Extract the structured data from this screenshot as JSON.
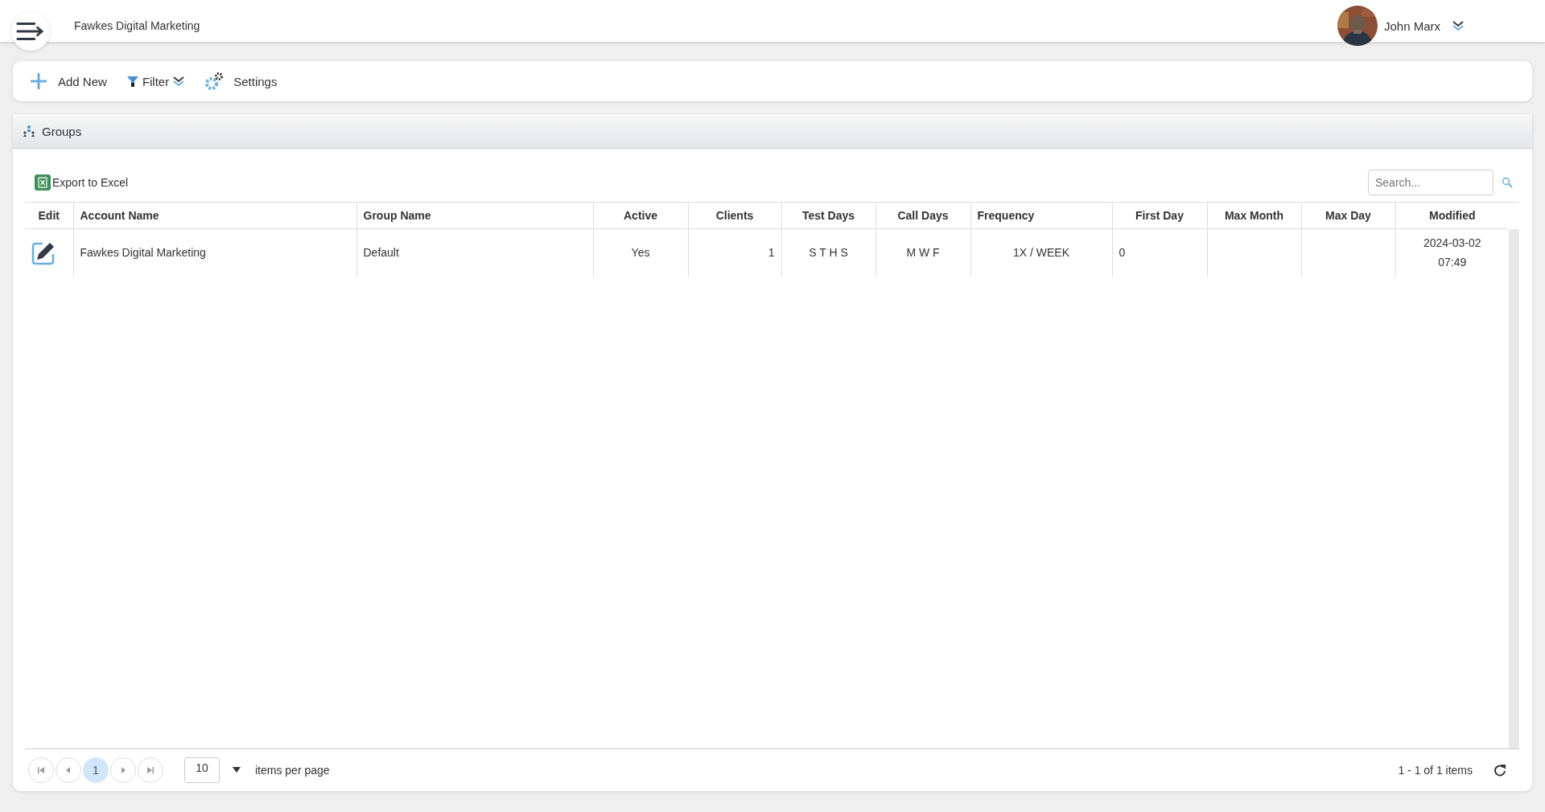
{
  "header": {
    "company": "Fawkes Digital Marketing",
    "user": {
      "name": "John Marx"
    }
  },
  "toolbar": [
    {
      "kind": "add",
      "label": "Add New"
    },
    {
      "kind": "filter",
      "label": "Filter"
    },
    {
      "kind": "settings",
      "label": "Settings"
    }
  ],
  "panel": {
    "title": "Groups",
    "export": "Export to Excel",
    "search": {
      "placeholder": "Search..."
    },
    "table": {
      "columns": [
        {
          "label": "Edit"
        },
        {
          "label": "Account Name"
        },
        {
          "label": "Group Name"
        },
        {
          "label": "Active"
        },
        {
          "label": "Clients"
        },
        {
          "label": "Test Days"
        },
        {
          "label": "Call Days"
        },
        {
          "label": "Frequency"
        },
        {
          "label": "First Day"
        },
        {
          "label": "Max Month"
        },
        {
          "label": "Max Day"
        },
        {
          "label": "Modified"
        }
      ],
      "rows": [
        {
          "cells": [
            null,
            "Fawkes Digital Marketing",
            "Default",
            "Yes",
            "1",
            "S T H S",
            "M W F",
            "1X / WEEK",
            "0",
            null,
            null,
            "2024-03-02\n07:49"
          ]
        }
      ]
    },
    "pager": {
      "buttons": [
        {
          "kind": "first",
          "selected": false
        },
        {
          "kind": "prev",
          "selected": false
        },
        {
          "kind": "page",
          "label": "1",
          "selected": true
        },
        {
          "kind": "next",
          "selected": false
        },
        {
          "kind": "last",
          "selected": false
        }
      ],
      "page_size": "10",
      "page_size_label": "items per page",
      "summary": "1 - 1 of 1 items"
    }
  }
}
